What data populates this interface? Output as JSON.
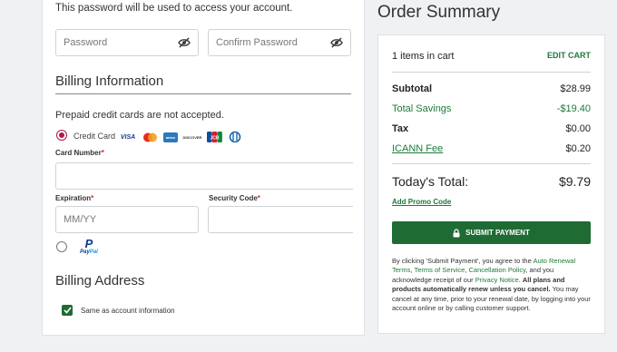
{
  "password_note": "This password will be used to access your account.",
  "fields": {
    "password_placeholder": "Password",
    "confirm_placeholder": "Confirm Password",
    "expiration_placeholder": "MM/YY"
  },
  "billing": {
    "heading": "Billing Information",
    "prepaid_note": "Prepaid credit cards are not accepted.",
    "credit_card_label": "Credit Card",
    "card_number_label": "Card Number",
    "expiration_label": "Expiration",
    "security_label": "Security Code",
    "required_mark": "*",
    "card_brands": [
      "VISA",
      "mastercard",
      "amex",
      "DISCOVER",
      "JCB",
      "Diners"
    ],
    "paypal": {
      "pay": "Pay",
      "pal": "Pal"
    }
  },
  "billing_address": {
    "heading": "Billing Address",
    "same_as_account": "Same as account information"
  },
  "summary": {
    "title": "Order Summary",
    "items_in_cart": "1 items in cart",
    "edit_cart": "EDIT CART",
    "lines": [
      {
        "label": "Subtotal",
        "value": "$28.99"
      },
      {
        "label": "Total Savings",
        "value": "-$19.40"
      },
      {
        "label": "Tax",
        "value": "$0.00"
      },
      {
        "label": "ICANN Fee",
        "value": "$0.20"
      }
    ],
    "total_label": "Today's Total:",
    "total_value": "$9.79",
    "promo": "Add Promo Code",
    "submit": "SUBMIT PAYMENT",
    "legal": {
      "p1": "By clicking 'Submit Payment', you agree to the ",
      "auto_renewal": "Auto Renewal Terms",
      "comma": ", ",
      "terms": "Terms of Service",
      "comma2": ", ",
      "cancellation": "Cancellation Policy",
      "p2": ", and you acknowledge receipt of our ",
      "privacy": "Privacy Notice",
      "p3": ". ",
      "bold": "All plans and products automatically renew unless you cancel.",
      "p4": " You may cancel at any time, prior to your renewal date, by logging into your account online or by calling customer support."
    }
  },
  "colors": {
    "accent_green": "#1e7a3a",
    "button_green": "#1f6b34",
    "radio_red": "#b0174e"
  }
}
